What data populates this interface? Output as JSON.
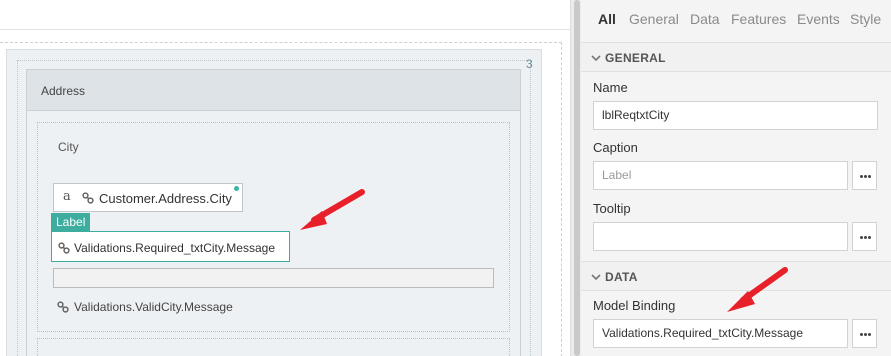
{
  "canvas": {
    "column_number": "3",
    "section_title": "Address",
    "city_label": "City",
    "input_widget": {
      "glyph": "a",
      "binding": "Customer.Address.City"
    },
    "selected_widget": {
      "tag": "Label",
      "binding": "Validations.Required_txtCity.Message"
    },
    "valid_message": "Validations.ValidCity.Message"
  },
  "panel": {
    "tabs": [
      {
        "label": "All",
        "active": true
      },
      {
        "label": "General",
        "active": false
      },
      {
        "label": "Data",
        "active": false
      },
      {
        "label": "Features",
        "active": false
      },
      {
        "label": "Events",
        "active": false
      },
      {
        "label": "Style",
        "active": false
      }
    ],
    "general": {
      "header": "GENERAL",
      "name_label": "Name",
      "name_value": "lblReqtxtCity",
      "caption_label": "Caption",
      "caption_placeholder": "Label",
      "tooltip_label": "Tooltip",
      "tooltip_value": ""
    },
    "data": {
      "header": "DATA",
      "model_binding_label": "Model Binding",
      "model_binding_value": "Validations.Required_txtCity.Message"
    }
  },
  "colors": {
    "accent_teal": "#3dada0",
    "arrow_red": "#e8202a"
  },
  "icons": [
    "link-icon",
    "dots-icon",
    "chevron-down-icon",
    "arrow-annotation"
  ]
}
